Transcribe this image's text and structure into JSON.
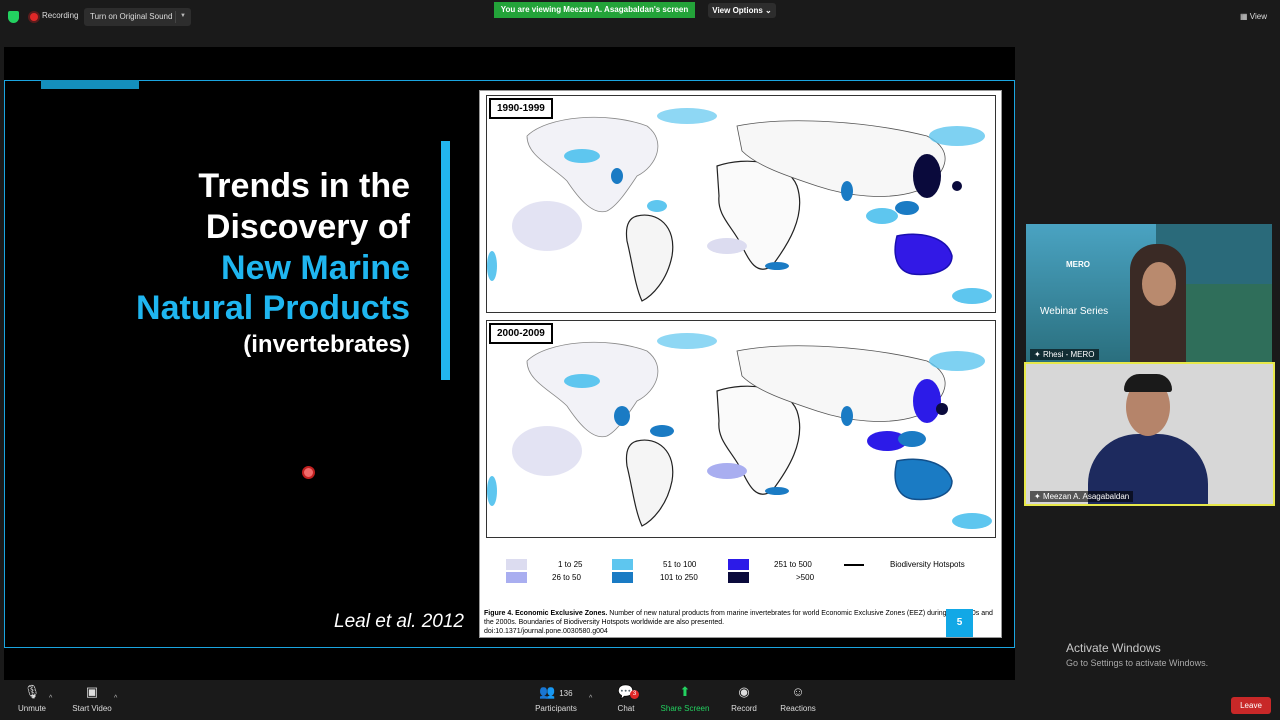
{
  "topbar": {
    "recording_label": "Recording",
    "original_sound_label": "Turn on Original Sound",
    "viewing_banner": "You are viewing Meezan A. Asagabaldan's screen",
    "view_options_label": "View Options",
    "view_label": "View"
  },
  "slide": {
    "title_line1": "Trends in the",
    "title_line2": "Discovery of",
    "title_line3": "New Marine",
    "title_line4": "Natural Products",
    "title_sub": "(invertebrates)",
    "citation": "Leal et al. 2012",
    "figure": {
      "period1": "1990-1999",
      "period2": "2000-2009",
      "legend": [
        {
          "label": "1 to 25",
          "color": "#dcdcf0"
        },
        {
          "label": "26 to 50",
          "color": "#a9aef0"
        },
        {
          "label": "51 to 100",
          "color": "#5ec6ef"
        },
        {
          "label": "101 to 250",
          "color": "#1a7bc4"
        },
        {
          "label": "251 to 500",
          "color": "#2c1be8"
        },
        {
          "label": ">500",
          "color": "#0a0a3c"
        }
      ],
      "legend_hotspots": "Biodiversity Hotspots",
      "caption_bold": "Figure 4. Economic Exclusive Zones.",
      "caption_text": " Number of new natural products from marine invertebrates for world Economic Exclusive Zones (EEZ) during the 1990s and the 2000s. Boundaries of Biodiversity Hotspots worldwide are also presented.",
      "caption_doi": "doi:10.1371/journal.pone.0030580.g004",
      "page_number": "5"
    }
  },
  "participants": {
    "tile1_name": "Rhesi - MERO",
    "tile1_caption": "Webinar Series",
    "tile1_logo": "MERO",
    "tile2_name": "Meezan A. Asagabaldan"
  },
  "watermark": {
    "line1": "Activate Windows",
    "line2": "Go to Settings to activate Windows."
  },
  "toolbar": {
    "unmute": "Unmute",
    "start_video": "Start Video",
    "participants": "Participants",
    "participants_count": "136",
    "chat": "Chat",
    "chat_badge": "3",
    "share_screen": "Share Screen",
    "record": "Record",
    "reactions": "Reactions",
    "leave": "Leave"
  }
}
